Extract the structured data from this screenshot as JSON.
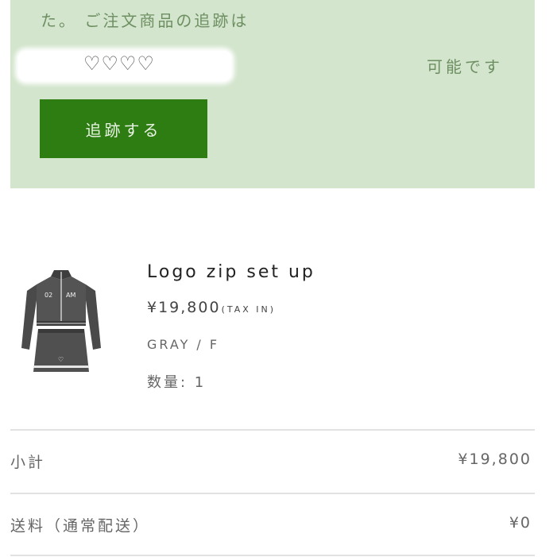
{
  "notice": {
    "text": "た。 ご注文商品の追跡は",
    "redacted_hearts": "♡♡♡♡",
    "possible_text": "可能です",
    "track_button_label": "追跡する"
  },
  "product": {
    "name": "Logo zip set up",
    "price": "¥19,800",
    "tax_note": "(TAX IN)",
    "variant": "GRAY / F",
    "quantity": "数量: 1",
    "image": {
      "chest_text_left": "02",
      "chest_text_right": "AM",
      "emblem": "♡"
    }
  },
  "summary": {
    "subtotal_label": "小計",
    "subtotal_value": "¥19,800",
    "shipping_label": "送料（通常配送）",
    "shipping_value": "¥0"
  },
  "colors": {
    "notice_bg": "#d3e5cd",
    "notice_text": "#6e8f62",
    "button_bg": "#2e7d13",
    "button_text": "#e9f3e4"
  }
}
